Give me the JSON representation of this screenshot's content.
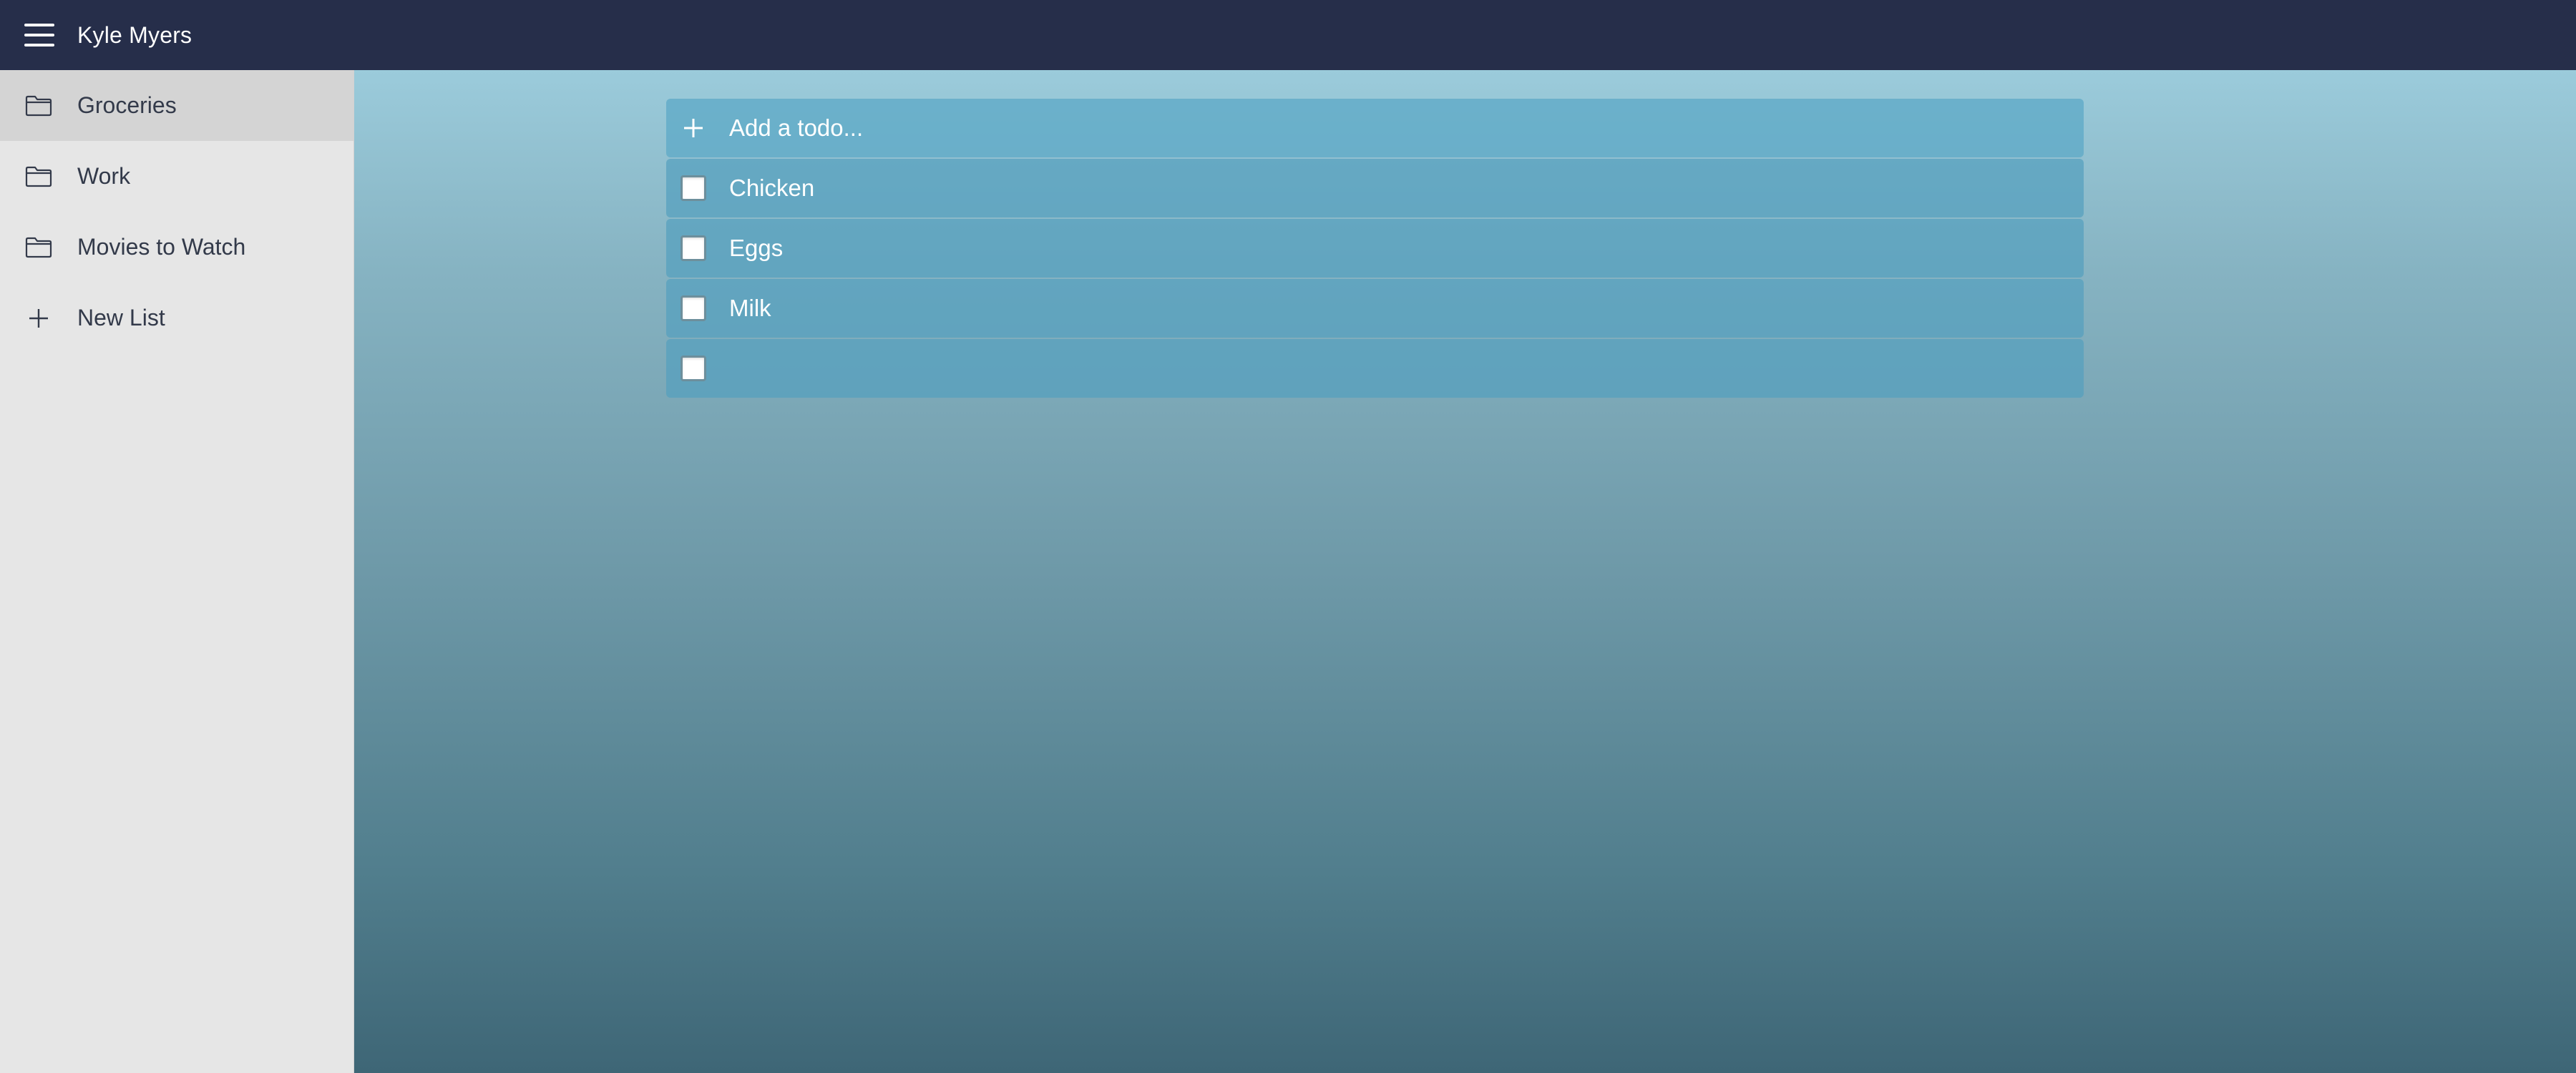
{
  "header": {
    "menu_icon": "hamburger-menu-icon",
    "user_name": "Kyle Myers"
  },
  "sidebar": {
    "items": [
      {
        "label": "Groceries",
        "icon": "folder-icon",
        "active": true
      },
      {
        "label": "Work",
        "icon": "folder-icon",
        "active": false
      },
      {
        "label": "Movies to Watch",
        "icon": "folder-icon",
        "active": false
      },
      {
        "label": "New List",
        "icon": "plus-icon",
        "active": false
      }
    ]
  },
  "todos": {
    "add_placeholder": "Add a todo...",
    "add_icon": "plus-icon",
    "items": [
      {
        "text": "Chicken",
        "checked": false
      },
      {
        "text": "Eggs",
        "checked": false
      },
      {
        "text": "Milk",
        "checked": false
      },
      {
        "text": "",
        "checked": false
      }
    ]
  },
  "colors": {
    "topbar": "#262e4a",
    "sidebar": "#e6e6e6",
    "sidebar_active": "#d4d4d4",
    "background_top": "#9bcbdb",
    "background_bottom": "#3e6676"
  }
}
